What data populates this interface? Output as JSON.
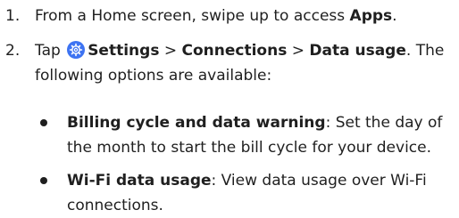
{
  "steps": [
    {
      "number": "1.",
      "before": "From a Home screen, swipe up to access ",
      "bold": "Apps",
      "after": "."
    },
    {
      "number": "2.",
      "before": "Tap ",
      "bold_settings": "Settings",
      "sep1": " > ",
      "bold_connections": "Connections",
      "sep2": " > ",
      "bold_data_usage": "Data usage",
      "after": ". The following options are available:"
    }
  ],
  "options": [
    {
      "title": "Billing cycle and data warning",
      "description": ": Set the day of the month to start the bill cycle for your device."
    },
    {
      "title": "Wi-Fi data usage",
      "description": ": View data usage over Wi-Fi connections."
    }
  ],
  "icons": {
    "settings": "gear-icon"
  },
  "colors": {
    "settings_icon": "#3d73f2",
    "text": "#1f1f1f"
  }
}
